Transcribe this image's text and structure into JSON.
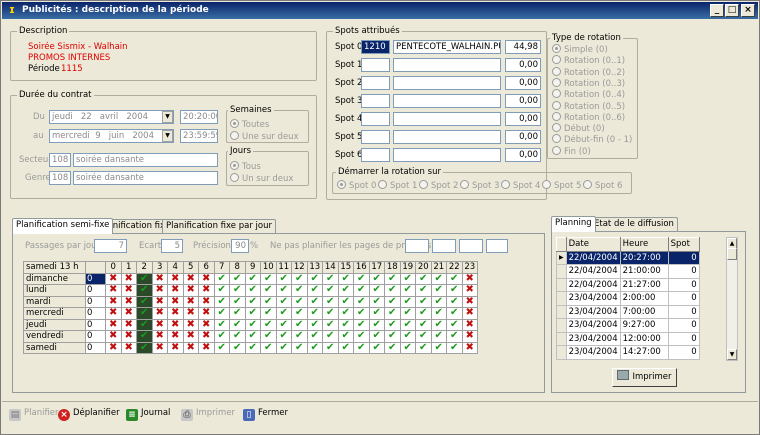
{
  "window": {
    "title": "Publicités : description de la période",
    "min": "_",
    "max": "□",
    "close": "×"
  },
  "description": {
    "legend": "Description",
    "line1": "Soirée Sismix - Walhain",
    "line2": "PROMOS INTERNES",
    "period_label": "Période",
    "period_value": "1115"
  },
  "contract": {
    "legend": "Durée du contrat",
    "du_label": "Du",
    "du_day": "jeudi",
    "du_date": "22",
    "du_month": "avril",
    "du_year": "2004",
    "du_time": "20:20:00",
    "au_label": "au",
    "au_day": "mercredi",
    "au_date": "9",
    "au_month": "juin",
    "au_year": "2004",
    "au_time": "23:59:59",
    "secteur_label": "Secteur",
    "secteur_code": "108",
    "secteur_name": "soirée dansante",
    "genre_label": "Genre",
    "genre_code": "108",
    "genre_name": "soirée dansante",
    "semaines_legend": "Semaines",
    "semaines_opt1": "Toutes",
    "semaines_opt2": "Une sur deux",
    "jours_legend": "Jours",
    "jours_opt1": "Tous",
    "jours_opt2": "Un sur deux"
  },
  "spots": {
    "legend": "Spots attribués",
    "rows": [
      {
        "label": "Spot 0",
        "code": "1210",
        "name": "PENTECOTE_WALHAIN.PU",
        "value": "44,98"
      },
      {
        "label": "Spot 1",
        "code": "",
        "name": "",
        "value": "0,00"
      },
      {
        "label": "Spot 2",
        "code": "",
        "name": "",
        "value": "0,00"
      },
      {
        "label": "Spot 3",
        "code": "",
        "name": "",
        "value": "0,00"
      },
      {
        "label": "Spot 4",
        "code": "",
        "name": "",
        "value": "0,00"
      },
      {
        "label": "Spot 5",
        "code": "",
        "name": "",
        "value": "0,00"
      },
      {
        "label": "Spot 6",
        "code": "",
        "name": "",
        "value": "0,00"
      }
    ],
    "start_legend": "Démarrer la rotation sur",
    "start_options": [
      "Spot 0",
      "Spot 1",
      "Spot 2",
      "Spot 3",
      "Spot 4",
      "Spot 5",
      "Spot 6"
    ]
  },
  "rotation": {
    "legend": "Type de rotation",
    "options": [
      "Simple (0)",
      "Rotation (0..1)",
      "Rotation (0..2)",
      "Rotation (0..3)",
      "Rotation (0..4)",
      "Rotation (0..5)",
      "Rotation (0..6)",
      "Début (0)",
      "Début-fin (0 - 1)",
      "Fin (0)"
    ]
  },
  "planning_tabs": [
    "Planification semi-fixe",
    "Planification fixe",
    "Planification fixe par jour"
  ],
  "planning_params": {
    "passages_label": "Passages par jour",
    "passages_value": "7",
    "ecart_label": "Ecart",
    "ecart_value": "5",
    "precision_label": "Précision",
    "precision_value": "90",
    "precision_unit": "%",
    "priority_label": "Ne pas planifier les pages de priorités"
  },
  "grid": {
    "header": "samedi 13 h",
    "hours": [
      "0",
      "1",
      "2",
      "3",
      "4",
      "5",
      "6",
      "7",
      "8",
      "9",
      "10",
      "11",
      "12",
      "13",
      "14",
      "15",
      "16",
      "17",
      "18",
      "19",
      "20",
      "21",
      "22",
      "23"
    ],
    "days": [
      {
        "name": "dimanche",
        "value": "0"
      },
      {
        "name": "lundi",
        "value": "0"
      },
      {
        "name": "mardi",
        "value": "0"
      },
      {
        "name": "mercredi",
        "value": "0"
      },
      {
        "name": "jeudi",
        "value": "0"
      },
      {
        "name": "vendredi",
        "value": "0"
      },
      {
        "name": "samedi",
        "value": "0"
      }
    ]
  },
  "side_tabs": [
    "Planning",
    "Etat de le diffusion"
  ],
  "planning_table": {
    "headers": [
      "Date",
      "Heure",
      "Spot"
    ],
    "rows": [
      {
        "date": "22/04/2004",
        "time": "20:27:00",
        "spot": "0"
      },
      {
        "date": "22/04/2004",
        "time": "21:00:00",
        "spot": "0"
      },
      {
        "date": "22/04/2004",
        "time": "21:27:00",
        "spot": "0"
      },
      {
        "date": "23/04/2004",
        "time": "2:00:00",
        "spot": "0"
      },
      {
        "date": "23/04/2004",
        "time": "7:00:00",
        "spot": "0"
      },
      {
        "date": "23/04/2004",
        "time": "9:27:00",
        "spot": "0"
      },
      {
        "date": "23/04/2004",
        "time": "12:00:00",
        "spot": "0"
      },
      {
        "date": "23/04/2004",
        "time": "14:27:00",
        "spot": "0"
      }
    ]
  },
  "print_label": "Imprimer",
  "toolbar": {
    "planifier": "Planifier",
    "deplanifier": "Déplanifier",
    "journal": "Journal",
    "imprimer": "Imprimer",
    "fermer": "Fermer"
  },
  "colors": {
    "title_bar": "#0a246a",
    "check": "#1c9a1c",
    "cross": "#c01010",
    "red_text": "#e00000"
  }
}
